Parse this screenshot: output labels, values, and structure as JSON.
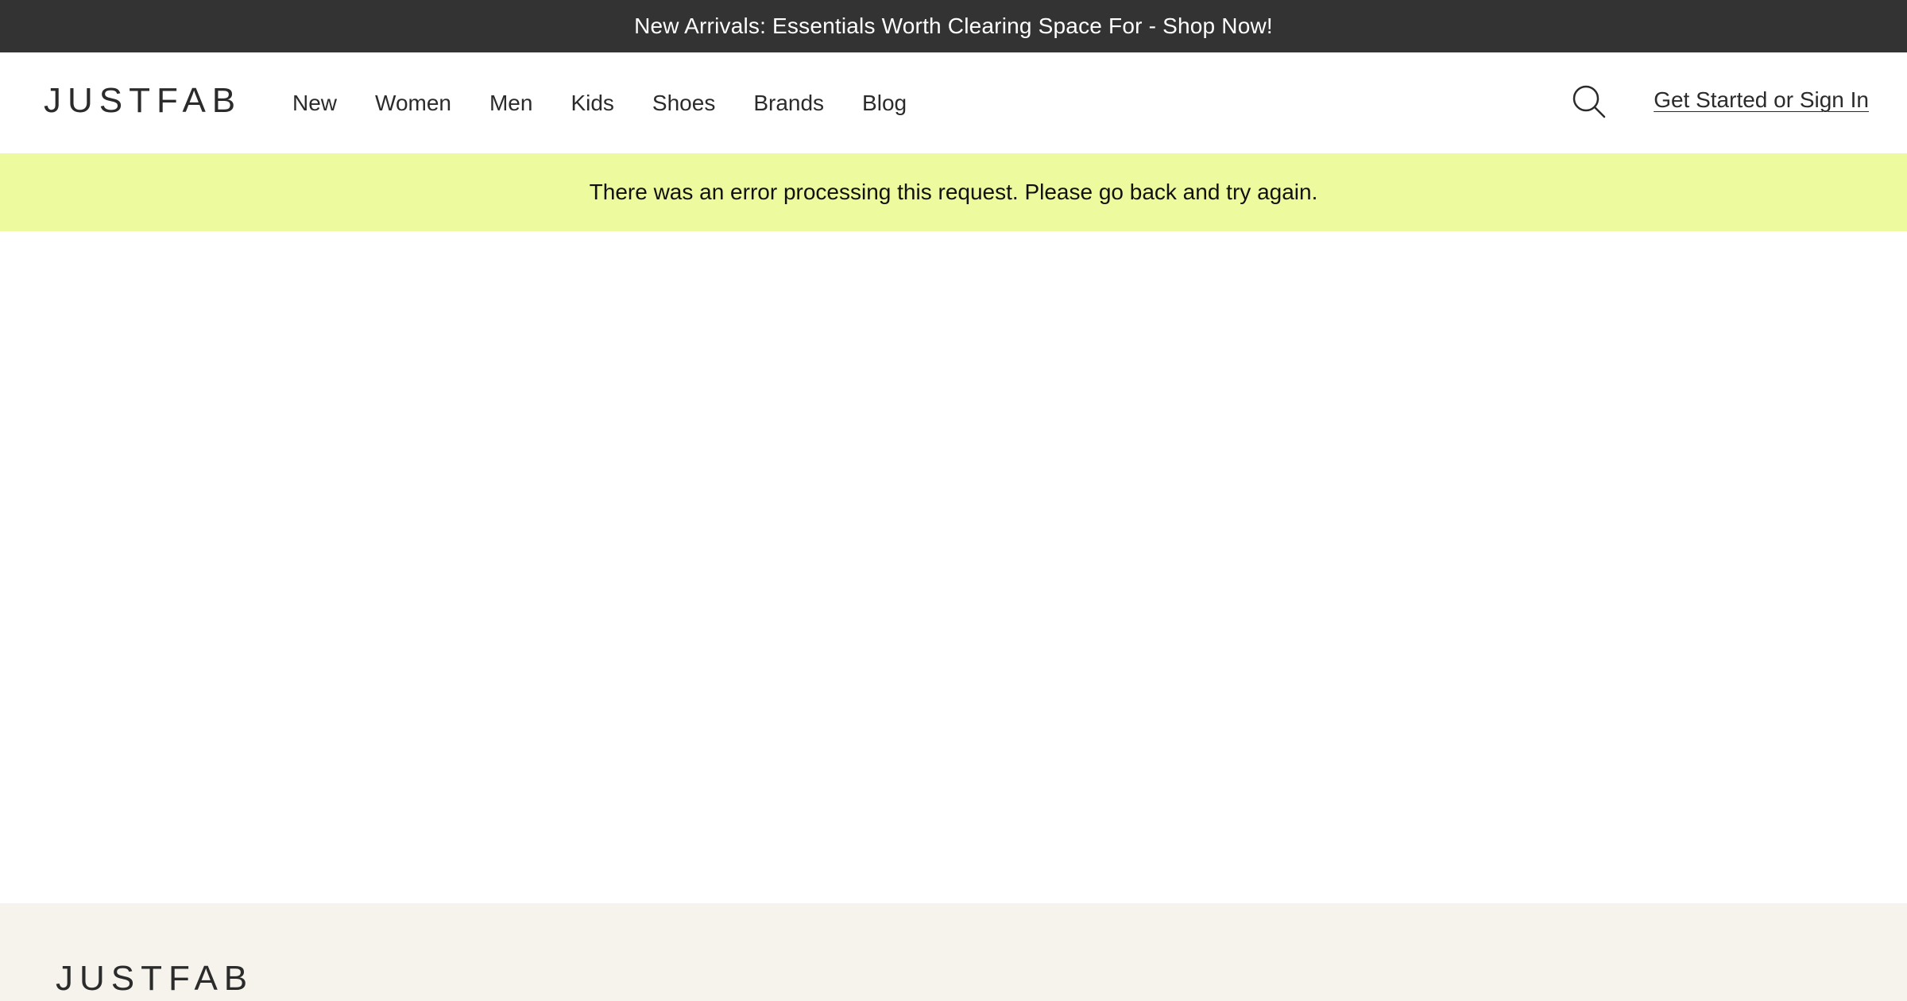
{
  "promo": {
    "text": "New Arrivals: Essentials Worth Clearing Space For - Shop Now!"
  },
  "header": {
    "logo": "JUSTFAB",
    "nav": [
      {
        "label": "New"
      },
      {
        "label": "Women"
      },
      {
        "label": "Men"
      },
      {
        "label": "Kids"
      },
      {
        "label": "Shoes"
      },
      {
        "label": "Brands"
      },
      {
        "label": "Blog"
      }
    ],
    "search_icon": "search-icon",
    "signin_label": "Get Started or Sign In"
  },
  "error": {
    "message": "There was an error processing this request. Please go back and try again."
  },
  "footer": {
    "logo": "JUSTFAB"
  },
  "colors": {
    "promo_bg": "#333333",
    "error_bg": "#edfa9d",
    "footer_bg": "#f6f3ec",
    "text": "#2b2b2b"
  }
}
